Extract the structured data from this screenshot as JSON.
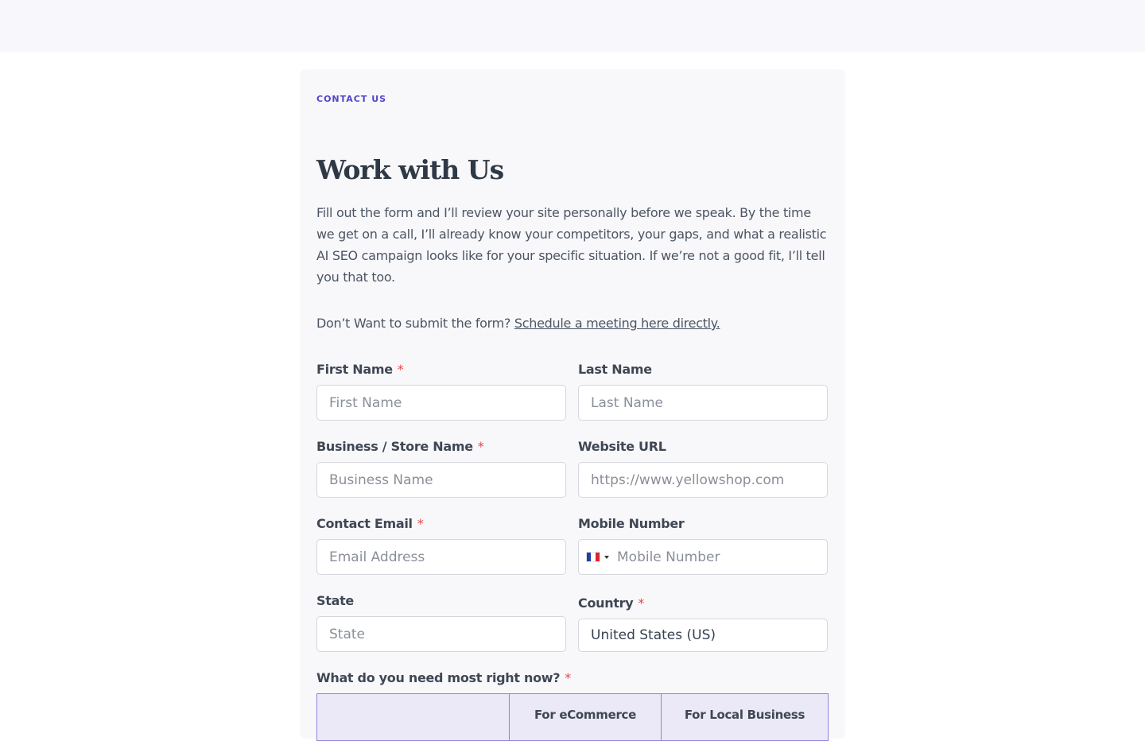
{
  "header": {},
  "contact": {
    "eyebrow": "CONTACT US",
    "title": "Work with Us",
    "intro": "Fill out the form and I’ll review your site personally before we speak. By the time we get on a call, I’ll already know your competitors, your gaps, and what a realistic AI SEO campaign looks like for your specific situation. If we’re not a good fit, I’ll tell you that too.",
    "schedule_prefix": "Don’t Want to submit the form? ",
    "schedule_link": "Schedule a meeting here directly."
  },
  "form": {
    "required_marker": "*",
    "first_name": {
      "label": "First Name",
      "placeholder": "First Name",
      "required": true
    },
    "last_name": {
      "label": "Last Name",
      "placeholder": "Last Name",
      "required": false
    },
    "business_name": {
      "label": "Business / Store Name",
      "placeholder": "Business Name",
      "required": true
    },
    "website_url": {
      "label": "Website URL",
      "placeholder": "https://www.yellowshop.com",
      "required": false
    },
    "contact_email": {
      "label": "Contact Email",
      "placeholder": "Email Address",
      "required": true
    },
    "mobile_number": {
      "label": "Mobile Number",
      "placeholder": "Mobile Number",
      "required": false,
      "flag_icon": "france-flag-icon",
      "flag_colors": [
        "#1f3ea8",
        "#ffffff",
        "#e0242e"
      ]
    },
    "state": {
      "label": "State",
      "placeholder": "State",
      "required": false
    },
    "country": {
      "label": "Country",
      "value": "United States (US)",
      "required": true
    },
    "need": {
      "label": "What do you need most right now?",
      "required": true,
      "columns": [
        "",
        "For eCommerce",
        "For Local Business"
      ]
    }
  },
  "colors": {
    "accent": "#4f46c8",
    "required": "#e5484d",
    "table_border": "#8b85d6",
    "table_bg": "#ebe9f8"
  }
}
